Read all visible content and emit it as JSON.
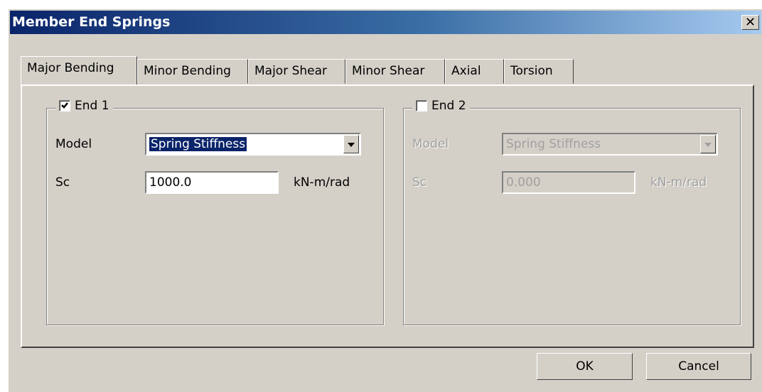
{
  "window": {
    "title": "Member End Springs",
    "close_glyph": "✕"
  },
  "tabs": [
    {
      "label": "Major Bending",
      "active": true
    },
    {
      "label": "Minor Bending"
    },
    {
      "label": "Major Shear"
    },
    {
      "label": "Minor Shear"
    },
    {
      "label": "Axial"
    },
    {
      "label": "Torsion"
    }
  ],
  "end1": {
    "label": "End 1",
    "checked": true,
    "model_label": "Model",
    "model_value": "Spring Stiffness",
    "sc_label": "Sc",
    "sc_value": "1000.0",
    "sc_unit": "kN-m/rad"
  },
  "end2": {
    "label": "End 2",
    "checked": false,
    "model_label": "Model",
    "model_value": "Spring Stiffness",
    "sc_label": "Sc",
    "sc_value": "0.000",
    "sc_unit": "kN-m/rad"
  },
  "buttons": {
    "ok": "OK",
    "cancel": "Cancel"
  },
  "colors": {
    "face": "#d4d0c8",
    "title_start": "#0a246a",
    "title_end": "#a6caf0",
    "disabled_text": "#a0a0a0"
  }
}
